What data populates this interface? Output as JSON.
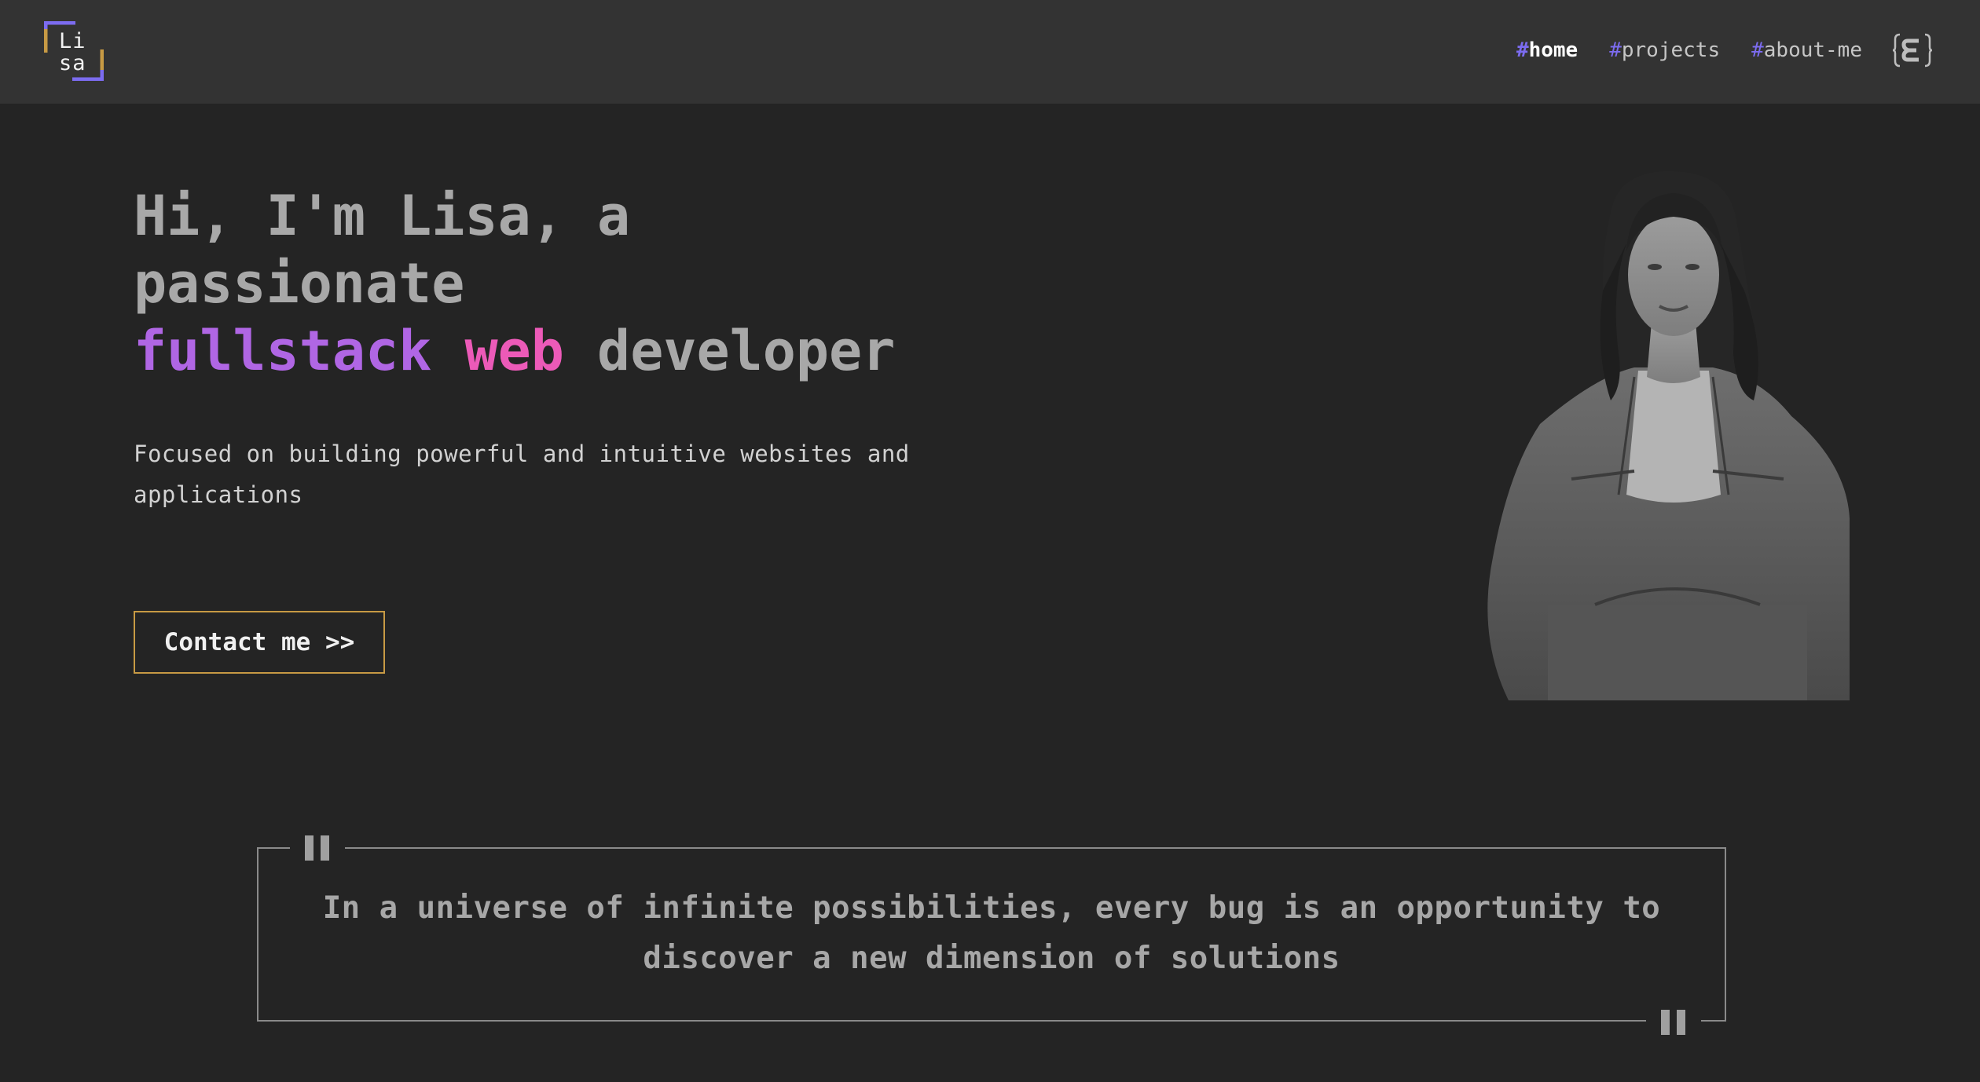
{
  "logo": {
    "line1": "Li",
    "line2": "sa",
    "accent_color": "#7c6cf0",
    "secondary_color": "#c79a44"
  },
  "nav": {
    "items": [
      {
        "hash": "#",
        "label": "home",
        "active": true
      },
      {
        "hash": "#",
        "label": "projects",
        "active": false
      },
      {
        "hash": "#",
        "label": "about-me",
        "active": false
      }
    ],
    "language_icon": "language-switch-icon"
  },
  "hero": {
    "title_line1": "Hi, I'm Lisa, a",
    "title_line2": "passionate",
    "title_highlight1": "fullstack",
    "title_highlight2": "web",
    "title_rest": "developer",
    "subtitle": "Focused on building powerful and intuitive websites and applications",
    "contact_button": "Contact me >>",
    "portrait_alt": "portrait"
  },
  "quote": {
    "text": "In a universe of infinite possibilities, every bug is an opportunity to discover a new dimension of solutions",
    "icon": "quote-mark-icon"
  },
  "colors": {
    "background": "#242424",
    "header": "#333333",
    "purple": "#b066e4",
    "pink": "#ec5ab8",
    "border_gold": "#c79a44"
  }
}
